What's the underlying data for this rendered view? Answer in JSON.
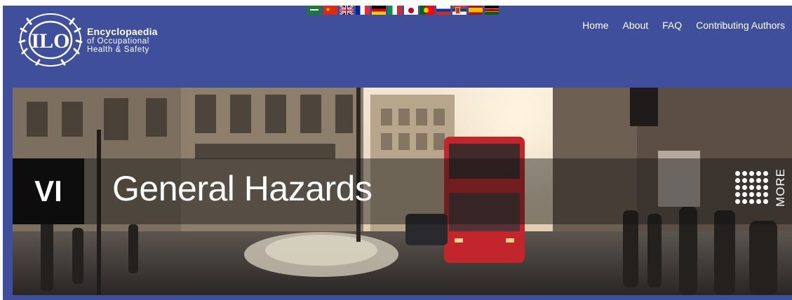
{
  "logo": {
    "seal_text": "ILO",
    "title": "Encyclopaedia",
    "sub_line1": "of Occupational",
    "sub_line2": "Health & Safety"
  },
  "languages": [
    "arabic-flag",
    "chinese-flag",
    "uk-flag",
    "french-flag",
    "german-flag",
    "italian-flag",
    "japanese-flag",
    "portuguese-flag",
    "russian-flag",
    "serbian-flag",
    "spanish-flag",
    "swahili-flag"
  ],
  "nav": {
    "home": "Home",
    "about": "About",
    "faq": "FAQ",
    "authors": "Contributing Authors"
  },
  "hero": {
    "volume": "VI",
    "title": "General Hazards",
    "more_label": "MORE"
  },
  "colors": {
    "header_bg": "#3f4f9c",
    "band_bg": "#0d0d0d",
    "bus_red": "#c2252b"
  }
}
